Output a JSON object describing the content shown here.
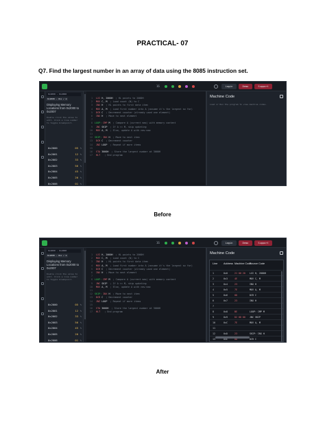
{
  "page": {
    "practical_title": "PRACTICAL- 07",
    "question": "Q7. Find the largest number in an array of data using the 8085 instruction set.",
    "caption_before": "Before",
    "caption_after": "After"
  },
  "sim": {
    "address_bar": "0x2000 - 0x2000",
    "chip_address": "0x2000 - 0x2007",
    "chip_flag": "✓ ⊕",
    "memory_heading": "Displaying Memory Locations from 0x2000 to 0x2007",
    "memory_note": "Double click the value to edit. Click a line number to toggle breakpoint.",
    "memory_rows": [
      {
        "addr": "0x2000",
        "value": "05"
      },
      {
        "addr": "0x2001",
        "value": "12"
      },
      {
        "addr": "0x2002",
        "value": "33"
      },
      {
        "addr": "0x2003",
        "value": "56"
      },
      {
        "addr": "0x2004",
        "value": "45"
      },
      {
        "addr": "0x2005",
        "value": "20"
      },
      {
        "addr": "0x2006",
        "value": "01"
      },
      {
        "addr": "0x2007",
        "value": "54"
      }
    ],
    "toolbar_num": "16",
    "login_label": "Login",
    "demo_label": "Demo",
    "support_label": "Support",
    "code_lines": [
      {
        "n": "1",
        "label": "",
        "op": "LXI",
        "arg": "H, 2000H",
        "comment": "; HL points to 2000H"
      },
      {
        "n": "2",
        "label": "",
        "op": "MOV",
        "arg": "C, M",
        "comment": "; Load count (N) to C"
      },
      {
        "n": "3",
        "label": "",
        "op": "INX",
        "arg": "H",
        "comment": "; HL points to first data item"
      },
      {
        "n": "4",
        "label": "",
        "op": "MOV",
        "arg": "A, M",
        "comment": "; Load first number into A (assume it's the largest so far)"
      },
      {
        "n": "5",
        "label": "",
        "op": "DCR",
        "arg": "C",
        "comment": "; Decrement counter (already used one element)"
      },
      {
        "n": "6",
        "label": "",
        "op": "INX",
        "arg": "H",
        "comment": "; Move to next element"
      },
      {
        "n": "7",
        "label": "",
        "op": "",
        "arg": "",
        "comment": ""
      },
      {
        "n": "8",
        "label": "LOOP:",
        "op": "CMP",
        "arg": "M",
        "comment": "; Compare A (current max) with memory content"
      },
      {
        "n": "9",
        "label": "",
        "op": "JNC",
        "arg": "SKIP",
        "comment": "; If A >= M, skip updating"
      },
      {
        "n": "10",
        "label": "",
        "op": "MOV",
        "arg": "A, M",
        "comment": "; Else, update A with new max"
      },
      {
        "n": "11",
        "label": "",
        "op": "",
        "arg": "",
        "comment": ""
      },
      {
        "n": "12",
        "label": "SKIP:",
        "op": "INX",
        "arg": "H",
        "comment": "; Move to next item"
      },
      {
        "n": "13",
        "label": "",
        "op": "DCR",
        "arg": "C",
        "comment": "; Decrement counter"
      },
      {
        "n": "14",
        "label": "",
        "op": "JNZ",
        "arg": "LOOP",
        "comment": "; Repeat if more items"
      },
      {
        "n": "15",
        "label": "",
        "op": "",
        "arg": "",
        "comment": ""
      },
      {
        "n": "16",
        "label": "",
        "op": "STA",
        "arg": "3000H",
        "comment": "; Store the largest number at 3000H"
      },
      {
        "n": "17",
        "label": "",
        "op": "HLT",
        "arg": "",
        "comment": "; End program"
      }
    ],
    "mc_title": "Machine Code",
    "mc_desc": "Load or Run the program to view machine codes.",
    "mc_headers": {
      "line": "Line",
      "address": "Address",
      "code": "Machine Code",
      "source": "Source Code"
    },
    "mc_rows": [
      {
        "line": "1",
        "addr": "0x0",
        "code": "21 00 20",
        "src": "LXI H, 2000H"
      },
      {
        "line": "2",
        "addr": "0x3",
        "code": "4E",
        "src": "MOV C, M"
      },
      {
        "line": "3",
        "addr": "0x4",
        "code": "23",
        "src": "INX H"
      },
      {
        "line": "4",
        "addr": "0x5",
        "code": "7E",
        "src": "MOV A, M"
      },
      {
        "line": "5",
        "addr": "0x6",
        "code": "0D",
        "src": "DCR C"
      },
      {
        "line": "6",
        "addr": "0x7",
        "code": "23",
        "src": "INX H"
      },
      {
        "line": "7",
        "addr": "",
        "code": "",
        "src": ""
      },
      {
        "line": "8",
        "addr": "0x8",
        "code": "BE",
        "src": "LOOP: CMP M"
      },
      {
        "line": "9",
        "addr": "0x9",
        "code": "D2 0D 00",
        "src": "JNC SKIP"
      },
      {
        "line": "10",
        "addr": "0xC",
        "code": "7E",
        "src": "MOV A, M"
      },
      {
        "line": "11",
        "addr": "",
        "code": "",
        "src": ""
      },
      {
        "line": "12",
        "addr": "0xD",
        "code": "23",
        "src": "SKIP: INX H"
      },
      {
        "line": "13",
        "addr": "0xE",
        "code": "0D",
        "src": "DCR C"
      }
    ]
  }
}
